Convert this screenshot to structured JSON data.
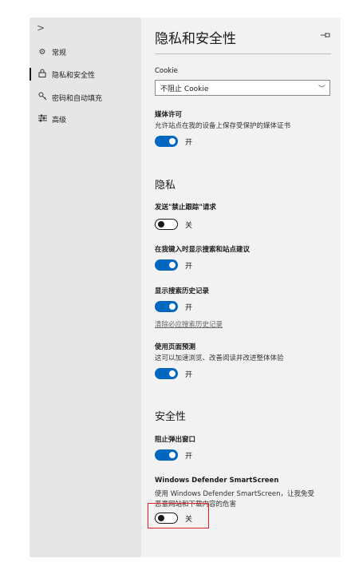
{
  "sidebar": {
    "expand_glyph": ">",
    "items": [
      {
        "label": "常规",
        "icon": "gear-icon"
      },
      {
        "label": "隐私和安全性",
        "icon": "lock-icon",
        "active": true
      },
      {
        "label": "密码和自动填充",
        "icon": "key-icon"
      },
      {
        "label": "高级",
        "icon": "sliders-icon"
      }
    ]
  },
  "main": {
    "title": "隐私和安全性",
    "pin_icon": "pin-icon",
    "cookie": {
      "label": "Cookie",
      "value": "不阻止 Cookie"
    },
    "media": {
      "label": "媒体许可",
      "desc": "允许站点在我的设备上保存受保护的媒体证书",
      "state": "开"
    },
    "privacy": {
      "heading": "隐私",
      "dnt": {
        "label": "发送\"禁止跟踪\"请求",
        "state": "关"
      },
      "suggest": {
        "label": "在我键入时显示搜索和站点建议",
        "state": "开"
      },
      "history": {
        "label": "显示搜索历史记录",
        "state": "开",
        "link": "清除必应搜索历史记录"
      },
      "predict": {
        "label": "使用页面预测",
        "desc": "这可以加速浏览、改善阅读并改进整体体验",
        "state": "开"
      }
    },
    "security": {
      "heading": "安全性",
      "popup": {
        "label": "阻止弹出窗口",
        "state": "开"
      },
      "smartscreen": {
        "label": "Windows Defender SmartScreen",
        "desc1": "使用 Windows Defender SmartScreen，让我免受",
        "desc2": "恶意网站和下载内容的危害",
        "state": "关"
      }
    }
  },
  "colors": {
    "accent": "#0067c0",
    "highlight": "#e02020"
  }
}
